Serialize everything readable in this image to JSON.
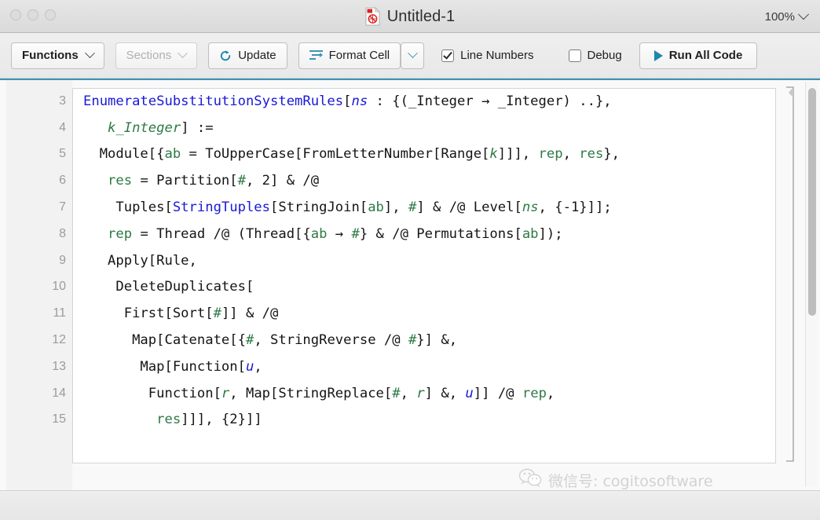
{
  "window": {
    "title": "Untitled-1",
    "doc_icon": "wolfram-notebook-icon",
    "zoom_level": "100%",
    "traffic_lights": [
      "close-button",
      "minimize-button",
      "maximize-button"
    ]
  },
  "toolbar": {
    "functions_label": "Functions",
    "sections_label": "Sections",
    "update_label": "Update",
    "format_cell_label": "Format Cell",
    "format_cell_menu": "⌄",
    "line_numbers_label": "Line Numbers",
    "line_numbers_checked": true,
    "debug_label": "Debug",
    "debug_checked": false,
    "run_all_label": "Run All Code",
    "accent_color": "#3d93b5",
    "rule_color": "#3d93b5"
  },
  "editor": {
    "line_numbers_visible": true,
    "first_line_number": 3,
    "lines": [
      {
        "number": "3",
        "tokens": [
          {
            "t": "EnumerateSubstitutionSystemRules",
            "c": "t-blue"
          },
          {
            "t": "[",
            "c": "t-blk"
          },
          {
            "t": "ns",
            "c": "t-blue-i"
          },
          {
            "t": " : {(_Integer → _Integer) ..},",
            "c": "t-blk"
          }
        ]
      },
      {
        "number": "4",
        "tokens": [
          {
            "t": "   ",
            "c": "t-blk"
          },
          {
            "t": "k_Integer",
            "c": "t-grn-i"
          },
          {
            "t": "] :=",
            "c": "t-blk"
          }
        ]
      },
      {
        "number": "5",
        "tokens": [
          {
            "t": "  Module[{",
            "c": "t-blk"
          },
          {
            "t": "ab",
            "c": "t-grn"
          },
          {
            "t": " = ToUpperCase[FromLetterNumber[Range[",
            "c": "t-blk"
          },
          {
            "t": "k",
            "c": "t-grn-i"
          },
          {
            "t": "]]], ",
            "c": "t-blk"
          },
          {
            "t": "rep",
            "c": "t-grn"
          },
          {
            "t": ", ",
            "c": "t-blk"
          },
          {
            "t": "res",
            "c": "t-grn"
          },
          {
            "t": "},",
            "c": "t-blk"
          }
        ]
      },
      {
        "number": "6",
        "tokens": [
          {
            "t": "   ",
            "c": "t-blk"
          },
          {
            "t": "res",
            "c": "t-grn"
          },
          {
            "t": " = Partition[",
            "c": "t-blk"
          },
          {
            "t": "#",
            "c": "t-grn"
          },
          {
            "t": ", 2] & /@",
            "c": "t-blk"
          }
        ]
      },
      {
        "number": "7",
        "tokens": [
          {
            "t": "    Tuples[",
            "c": "t-blk"
          },
          {
            "t": "StringTuples",
            "c": "t-blue"
          },
          {
            "t": "[StringJoin[",
            "c": "t-blk"
          },
          {
            "t": "ab",
            "c": "t-grn"
          },
          {
            "t": "], ",
            "c": "t-blk"
          },
          {
            "t": "#",
            "c": "t-grn"
          },
          {
            "t": "] & /@ Level[",
            "c": "t-blk"
          },
          {
            "t": "ns",
            "c": "t-grn-i"
          },
          {
            "t": ", {-1}]];",
            "c": "t-blk"
          }
        ]
      },
      {
        "number": "8",
        "tokens": [
          {
            "t": "   ",
            "c": "t-blk"
          },
          {
            "t": "rep",
            "c": "t-grn"
          },
          {
            "t": " = Thread /@ (Thread[{",
            "c": "t-blk"
          },
          {
            "t": "ab",
            "c": "t-grn"
          },
          {
            "t": " → ",
            "c": "t-blk"
          },
          {
            "t": "#",
            "c": "t-grn"
          },
          {
            "t": "} & /@ Permutations[",
            "c": "t-blk"
          },
          {
            "t": "ab",
            "c": "t-grn"
          },
          {
            "t": "]);",
            "c": "t-blk"
          }
        ]
      },
      {
        "number": "9",
        "tokens": [
          {
            "t": "   Apply[Rule,",
            "c": "t-blk"
          }
        ]
      },
      {
        "number": "10",
        "tokens": [
          {
            "t": "    DeleteDuplicates[",
            "c": "t-blk"
          }
        ]
      },
      {
        "number": "11",
        "tokens": [
          {
            "t": "     First[Sort[",
            "c": "t-blk"
          },
          {
            "t": "#",
            "c": "t-grn"
          },
          {
            "t": "]] & /@",
            "c": "t-blk"
          }
        ]
      },
      {
        "number": "12",
        "tokens": [
          {
            "t": "      Map[Catenate[{",
            "c": "t-blk"
          },
          {
            "t": "#",
            "c": "t-grn"
          },
          {
            "t": ", StringReverse /@ ",
            "c": "t-blk"
          },
          {
            "t": "#",
            "c": "t-grn"
          },
          {
            "t": "}] &,",
            "c": "t-blk"
          }
        ]
      },
      {
        "number": "13",
        "tokens": [
          {
            "t": "       Map[Function[",
            "c": "t-blk"
          },
          {
            "t": "u",
            "c": "t-blue-i"
          },
          {
            "t": ",",
            "c": "t-blk"
          }
        ]
      },
      {
        "number": "14",
        "tokens": [
          {
            "t": "        Function[",
            "c": "t-blk"
          },
          {
            "t": "r",
            "c": "t-grn-i"
          },
          {
            "t": ", Map[StringReplace[",
            "c": "t-blk"
          },
          {
            "t": "#",
            "c": "t-grn"
          },
          {
            "t": ", ",
            "c": "t-blk"
          },
          {
            "t": "r",
            "c": "t-grn-i"
          },
          {
            "t": "] &, ",
            "c": "t-blk"
          },
          {
            "t": "u",
            "c": "t-blue-i"
          },
          {
            "t": "]] /@ ",
            "c": "t-blk"
          },
          {
            "t": "rep",
            "c": "t-grn"
          },
          {
            "t": ",",
            "c": "t-blk"
          }
        ]
      },
      {
        "number": "15",
        "tokens": [
          {
            "t": "         ",
            "c": "t-blk"
          },
          {
            "t": "res",
            "c": "t-grn"
          },
          {
            "t": "]]], {2}]]",
            "c": "t-blk"
          }
        ]
      }
    ]
  },
  "watermark": {
    "text": "微信号: cogitosoftware",
    "icon": "wechat-icon"
  }
}
